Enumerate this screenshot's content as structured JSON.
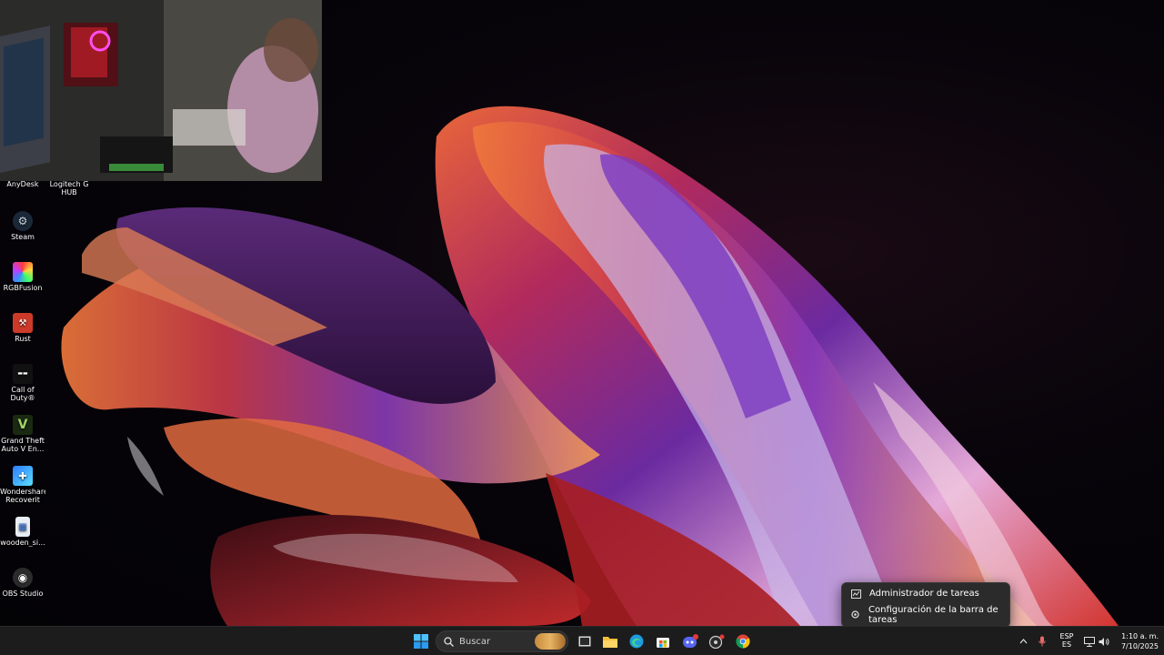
{
  "desktop_icons": [
    {
      "label": "AnyDesk",
      "icon": "anydesk-icon"
    },
    {
      "label": "Logitech G HUB",
      "icon": "logitech-icon"
    },
    {
      "label": "Steam",
      "icon": "steam-icon"
    },
    {
      "label": "RGBFusion",
      "icon": "rgbfusion-icon"
    },
    {
      "label": "Rust",
      "icon": "rust-icon"
    },
    {
      "label": "Call of Duty®",
      "icon": "call-of-duty-icon"
    },
    {
      "label": "Grand Theft Auto V En...",
      "icon": "gta-v-icon"
    },
    {
      "label": "Wondershare Recoverit",
      "icon": "wondershare-icon"
    },
    {
      "label": "wooden_si...",
      "icon": "file-icon"
    },
    {
      "label": "OBS Studio",
      "icon": "obs-icon"
    }
  ],
  "context_menu": {
    "items": [
      {
        "label": "Administrador de tareas",
        "icon": "task-manager-icon"
      },
      {
        "label": "Configuración de la barra de tareas",
        "icon": "settings-icon"
      }
    ]
  },
  "taskbar": {
    "search_placeholder": "Buscar",
    "apps": [
      "start-icon",
      "task-view-icon",
      "file-explorer-icon",
      "edge-icon",
      "store-icon",
      "discord-icon",
      "obs-taskbar-icon",
      "chrome-icon"
    ],
    "tray": {
      "language_top": "ESP",
      "language_bottom": "ES",
      "time": "1:10 a. m.",
      "date": "7/10/2025"
    }
  },
  "colors": {
    "taskbar_bg": "#1c1c1c",
    "menu_bg": "#2b2b2b",
    "windows_blue": "#0078d4"
  }
}
